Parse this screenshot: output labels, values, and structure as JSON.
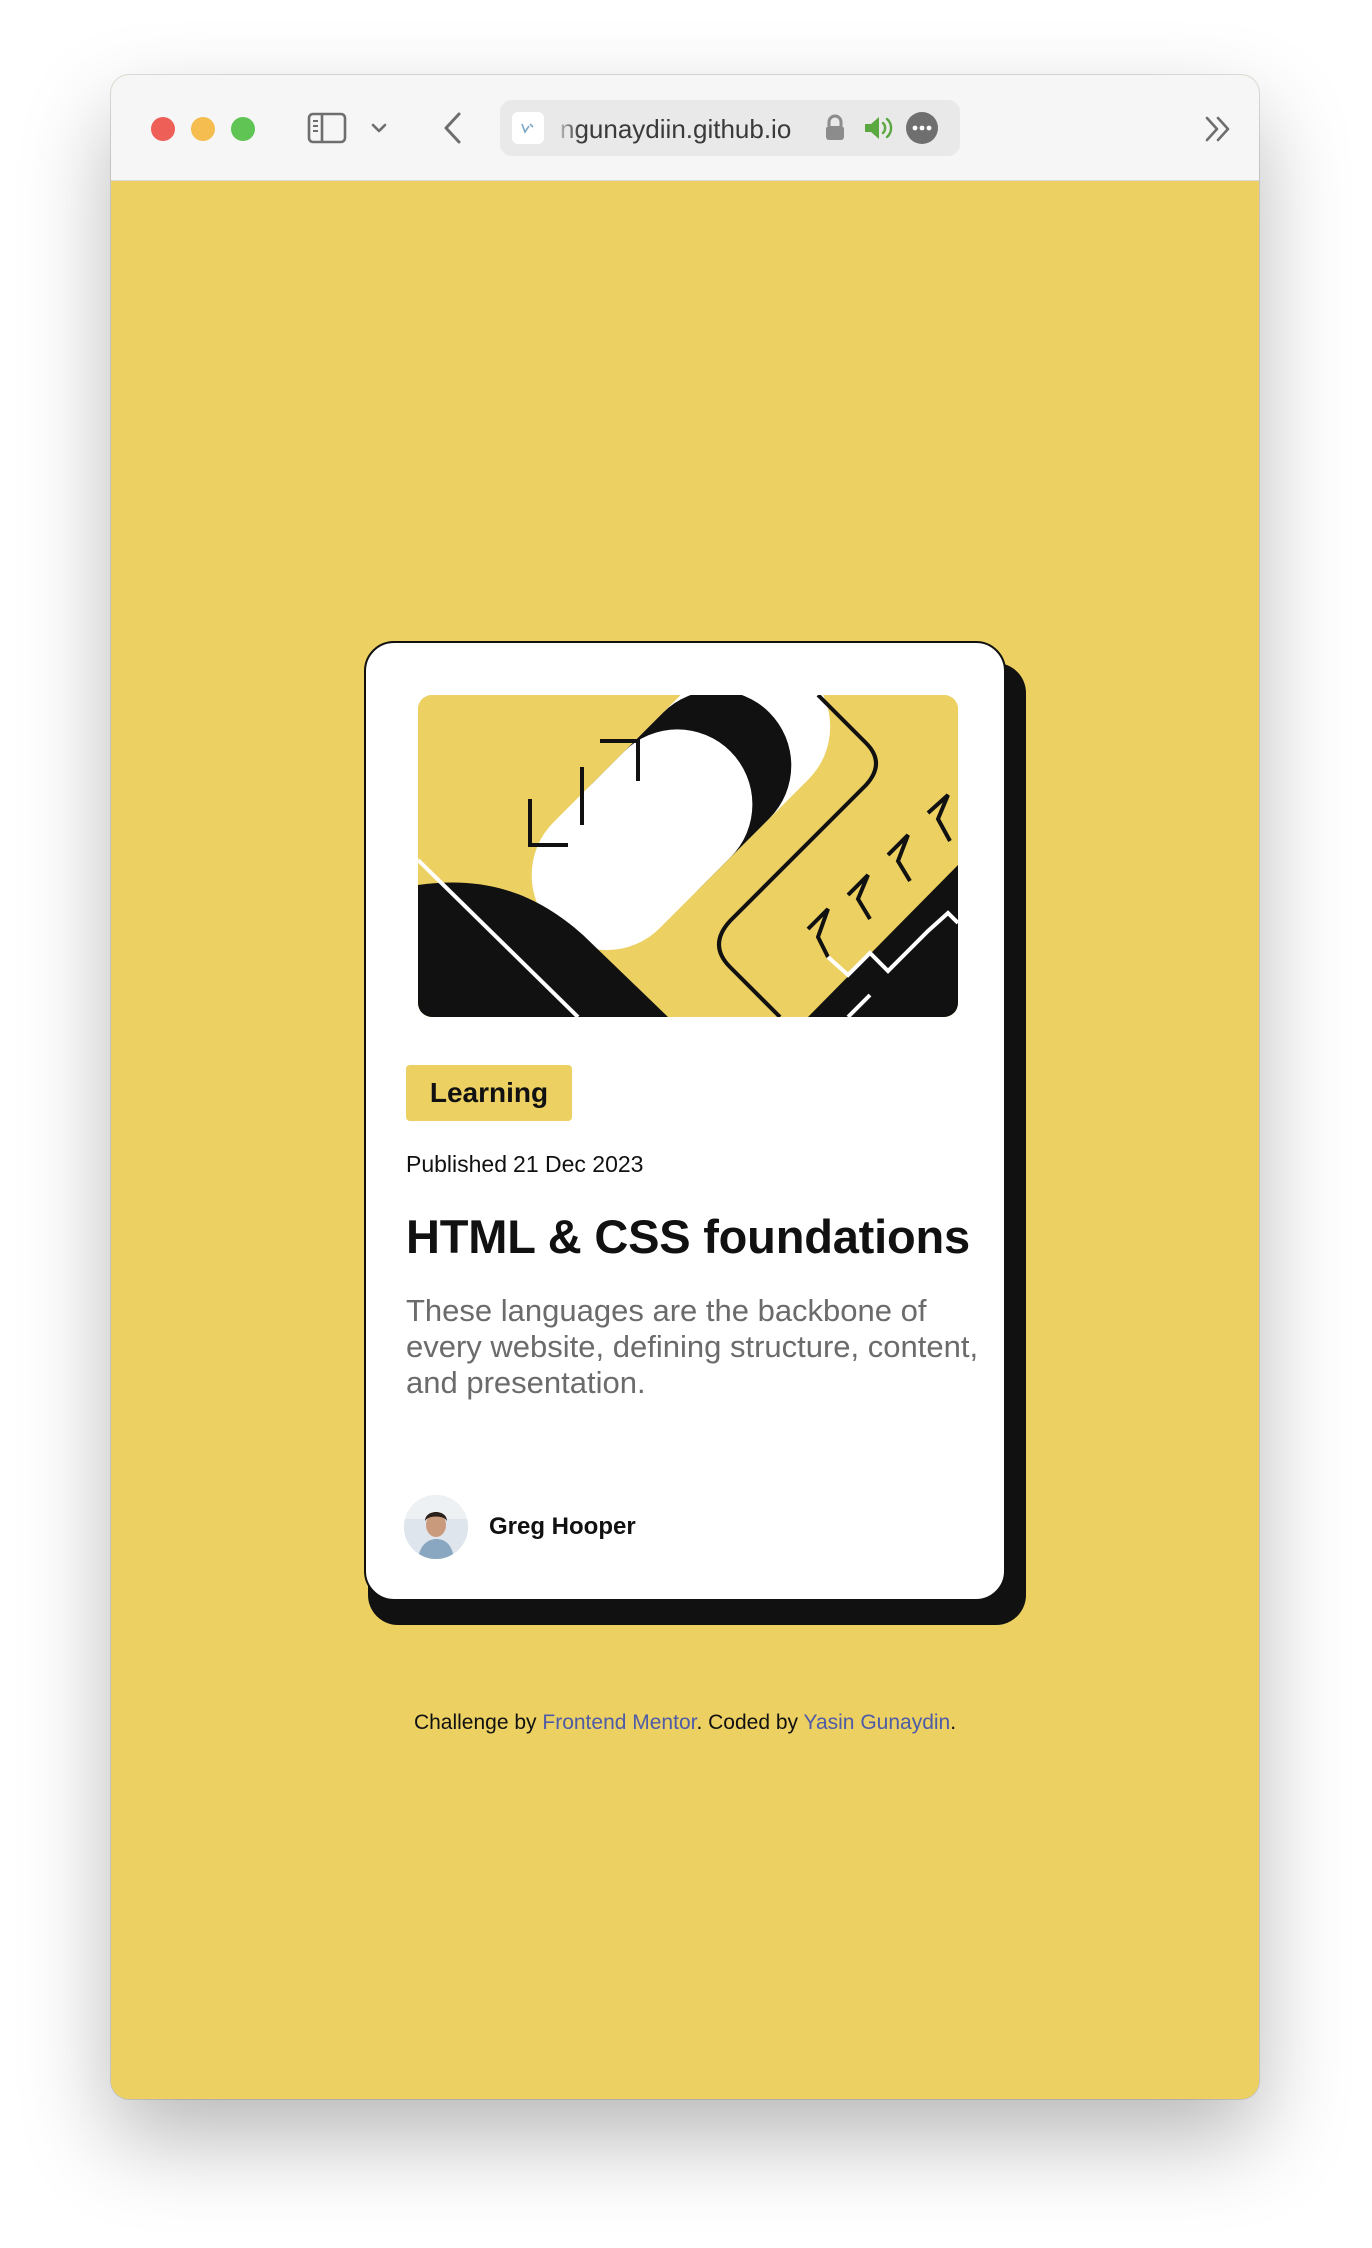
{
  "browser": {
    "url": "ngunaydiin.github.io",
    "icons": [
      "sidebar-icon",
      "chevron-down-icon",
      "back-icon",
      "lock-icon",
      "speaker-icon",
      "more-icon",
      "forward-more-icon"
    ]
  },
  "colors": {
    "background": "#ecd062",
    "card": "#ffffff",
    "ink": "#111111",
    "muted": "#6b6b6b",
    "link": "#4e5ba6"
  },
  "card": {
    "tag": "Learning",
    "published_prefix": "Published",
    "published_date": "21 Dec 2023",
    "title": "HTML & CSS foundations",
    "description": "These languages are the backbone of every website, defining structure, content, and presentation.",
    "author": "Greg Hooper"
  },
  "footer": {
    "prefix": "Challenge by",
    "frontend_mentor": "Frontend Mentor",
    "middle": ". Coded by",
    "coder": "Yasin Gunaydin",
    "suffix": "."
  }
}
